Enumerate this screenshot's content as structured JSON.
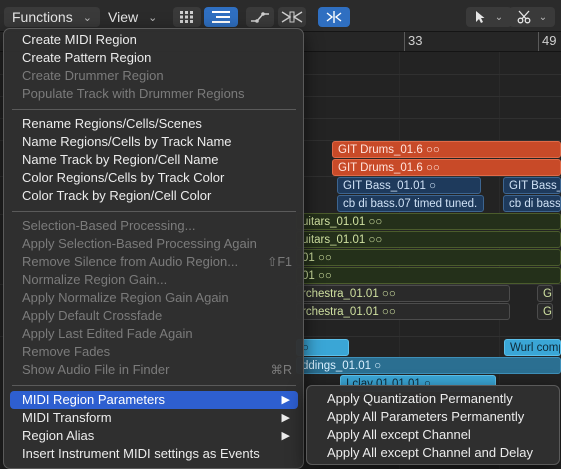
{
  "toolbar": {
    "functions_label": "Functions",
    "view_label": "View",
    "chevron": "⌄"
  },
  "ruler": {
    "bar_33": "33",
    "bar_49": "49"
  },
  "regions": [
    {
      "label": "GIT Drums_01.6  ○○"
    },
    {
      "label": "GIT Drums_01.6  ○○"
    },
    {
      "label": "GIT Bass_01.01   ○"
    },
    {
      "label": "GIT Bass_0"
    },
    {
      "label": "cb di bass.07 timed tuned."
    },
    {
      "label": "cb di bass"
    },
    {
      "label": "uitars_01.01  ○○"
    },
    {
      "label": "uitars_01.01  ○○"
    },
    {
      "label": "01  ○○"
    },
    {
      "label": "01  ○○"
    },
    {
      "label": "rchestra_01.01  ○○"
    },
    {
      "label": "G"
    },
    {
      "label": "rchestra_01.01  ○○"
    },
    {
      "label": "G"
    },
    {
      "label": "○"
    },
    {
      "label": "Wurl comp"
    },
    {
      "label": "ddings_01.01   ○"
    },
    {
      "label": "I clav 01.01.01   ○"
    }
  ],
  "menu": {
    "items": [
      {
        "label": "Create MIDI Region"
      },
      {
        "label": "Create Pattern Region"
      },
      {
        "label": "Create Drummer Region"
      },
      {
        "label": "Populate Track with Drummer Regions"
      },
      {
        "label": "Rename Regions/Cells/Scenes"
      },
      {
        "label": "Name Regions/Cells by Track Name"
      },
      {
        "label": "Name Track by Region/Cell Name"
      },
      {
        "label": "Color Regions/Cells by Track Color"
      },
      {
        "label": "Color Track by Region/Cell Color"
      },
      {
        "label": "Selection-Based Processing..."
      },
      {
        "label": "Apply Selection-Based Processing Again"
      },
      {
        "label": "Remove Silence from Audio Region...",
        "shortcut": "⇧F1"
      },
      {
        "label": "Normalize Region Gain..."
      },
      {
        "label": "Apply Normalize Region Gain Again"
      },
      {
        "label": "Apply Default Crossfade"
      },
      {
        "label": "Apply Last Edited Fade Again"
      },
      {
        "label": "Remove Fades"
      },
      {
        "label": "Show Audio File in Finder",
        "shortcut": "⌘R"
      },
      {
        "label": "MIDI Region Parameters"
      },
      {
        "label": "MIDI Transform"
      },
      {
        "label": "Region Alias"
      },
      {
        "label": "Insert Instrument MIDI settings as Events"
      }
    ],
    "submenu_arrow": "▶"
  },
  "submenu": {
    "items": [
      {
        "label": "Apply Quantization Permanently"
      },
      {
        "label": "Apply All Parameters Permanently"
      },
      {
        "label": "Apply All except Channel"
      },
      {
        "label": "Apply All except Channel and Delay"
      }
    ]
  },
  "colors": {
    "menu_highlight": "#2e5fd0",
    "toolbar_active": "#2f6fc1",
    "region_red": "#c84a28",
    "region_blue": "#1e3a5c",
    "region_cyan": "#3aa6d6"
  }
}
